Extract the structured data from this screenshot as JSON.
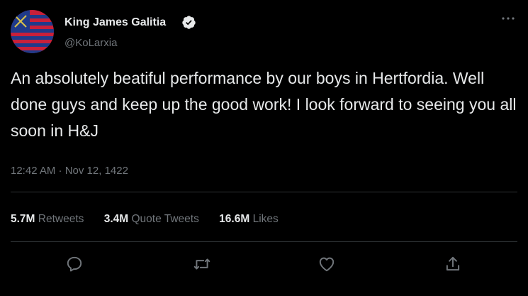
{
  "tweet": {
    "author": {
      "name": "King James Galitia",
      "handle": "@KoLarxia",
      "avatar_icon": "flag-avatar",
      "verified_icon": "verified-badge-icon"
    },
    "text": "An absolutely beatiful performance by our boys in Hertfordia. Well done guys and keep up the good work! I look forward to seeing you all soon in H&J",
    "timestamp": "12:42 AM · Nov 12, 1422",
    "stats": {
      "retweets": {
        "count": "5.7M",
        "label": "Retweets"
      },
      "quotes": {
        "count": "3.4M",
        "label": "Quote Tweets"
      },
      "likes": {
        "count": "16.6M",
        "label": "Likes"
      }
    },
    "actions": [
      "reply-icon",
      "retweet-icon",
      "like-icon",
      "share-icon"
    ]
  },
  "colors": {
    "background": "#000000",
    "text": "#e7e9ea",
    "secondary": "#71767b",
    "divider": "#2f3336",
    "avatar_red": "#c8203a",
    "avatar_blue": "#1f3a8a"
  }
}
